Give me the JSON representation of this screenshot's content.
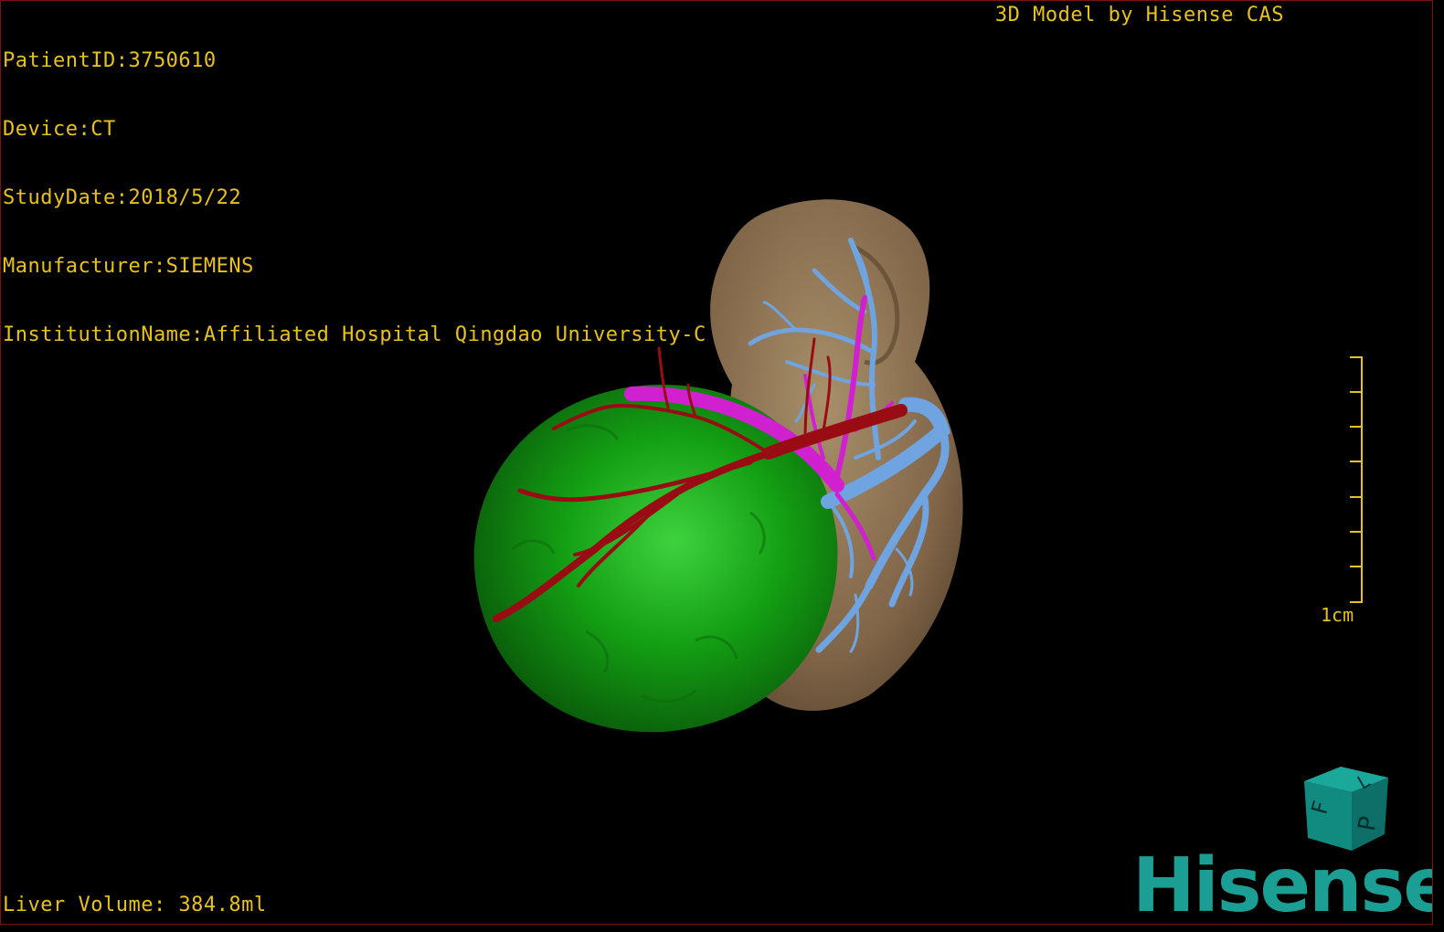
{
  "viewer": {
    "patient_id": "PatientID:3750610",
    "device": "Device:CT",
    "study_date": "StudyDate:2018/5/22",
    "manufacturer": "Manufacturer:SIEMENS",
    "institution": "InstitutionName:Affiliated Hospital Qingdao University-C",
    "model_credit": "3D Model by Hisense CAS",
    "liver_volume": "Liver Volume: 384.8ml",
    "scale_label": "1cm",
    "cube_letters": {
      "left": "F",
      "right": "L",
      "front": "P"
    },
    "logo": "Hisense"
  },
  "colors": {
    "overlay_text": "#e8c21c",
    "tumor": "#1a9a1a",
    "liver": "#8a7050",
    "artery": "#9a0c14",
    "portal_vein": "#d020d0",
    "hepatic_vein": "#6fa4e0",
    "logo": "#1b9e94",
    "border": "#7a1414"
  },
  "structures": [
    "liver",
    "tumor",
    "artery",
    "portal-vein",
    "hepatic-vein"
  ]
}
